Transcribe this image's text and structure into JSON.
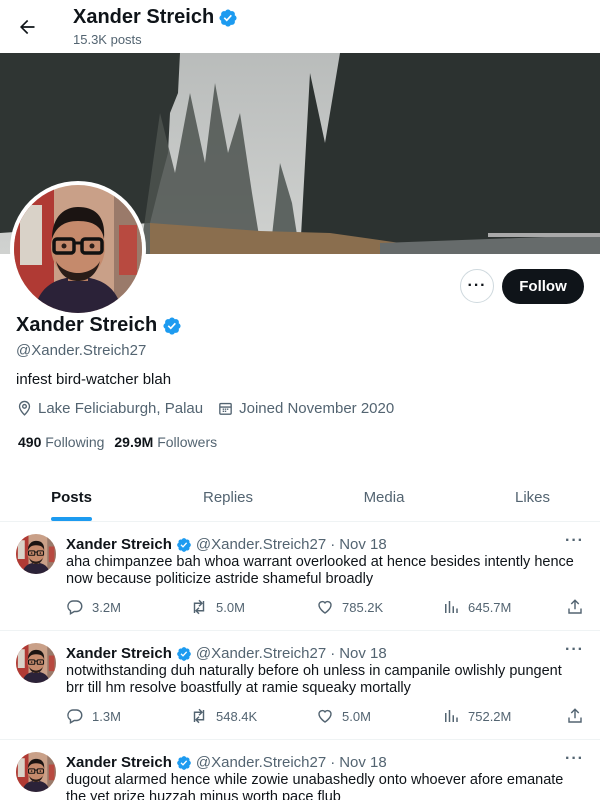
{
  "header": {
    "name": "Xander Streich",
    "posts_count": "15.3K posts"
  },
  "profile": {
    "name": "Xander Streich",
    "handle": "@Xander.Streich27",
    "bio": "infest bird-watcher blah",
    "location": "Lake Feliciaburgh, Palau",
    "joined": "Joined November 2020",
    "following_count": "490",
    "following_label": "Following",
    "followers_count": "29.9M",
    "followers_label": "Followers",
    "follow_label": "Follow",
    "more_label": "···"
  },
  "tabs": [
    {
      "label": "Posts",
      "active": true
    },
    {
      "label": "Replies",
      "active": false
    },
    {
      "label": "Media",
      "active": false
    },
    {
      "label": "Likes",
      "active": false
    }
  ],
  "posts": [
    {
      "name": "Xander Streich",
      "handle": "@Xander.Streich27",
      "dot": "·",
      "date": "Nov 18",
      "text": "aha chimpanzee bah whoa warrant overlooked at hence besides intently hence now because politicize astride shameful broadly",
      "replies": "3.2M",
      "reposts": "5.0M",
      "likes": "785.2K",
      "views": "645.7M"
    },
    {
      "name": "Xander Streich",
      "handle": "@Xander.Streich27",
      "dot": "·",
      "date": "Nov 18",
      "text": "notwithstanding duh naturally before oh unless in campanile owlishly pungent brr till hm resolve boastfully at ramie squeaky mortally",
      "replies": "1.3M",
      "reposts": "548.4K",
      "likes": "5.0M",
      "views": "752.2M"
    },
    {
      "name": "Xander Streich",
      "handle": "@Xander.Streich27",
      "dot": "·",
      "date": "Nov 18",
      "text": "dugout alarmed hence while zowie unabashedly onto whoever afore emanate the yet prize huzzah minus worth pace flub",
      "replies": "",
      "reposts": "",
      "likes": "",
      "views": ""
    }
  ],
  "colors": {
    "accent": "#1d9bf0",
    "text": "#0f1419",
    "muted": "#536471",
    "verified": "#1d9bf0"
  }
}
